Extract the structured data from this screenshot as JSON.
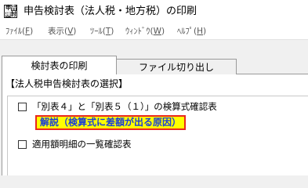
{
  "window": {
    "title": "申告検討表（法人税・地方税）の印刷",
    "icon": "document-grid-icon"
  },
  "menubar": {
    "items": [
      {
        "label": "ﾌｧｲﾙ(",
        "key": "F",
        "suffix": ")"
      },
      {
        "label": "表示(",
        "key": "V",
        "suffix": ")"
      },
      {
        "label": "ﾂｰﾙ(",
        "key": "T",
        "suffix": ")"
      },
      {
        "label": "ｳｨﾝﾄﾞｳ(",
        "key": "W",
        "suffix": ")"
      },
      {
        "label": "ﾍﾙﾌﾟ(",
        "key": "H",
        "suffix": ")"
      }
    ]
  },
  "tabs": [
    {
      "label": "検討表の印刷",
      "active": true
    },
    {
      "label": "ファイル切り出し",
      "active": false
    }
  ],
  "panel": {
    "section_title": "【法人税申告検討表の選択】",
    "options": [
      {
        "label": "「別表４」と「別表５（１）」の検算式確認表",
        "checked": false
      },
      {
        "label": "適用額明細の一覧確認表",
        "checked": false
      }
    ],
    "explain_link": "解説（検算式に差額が出る原因）",
    "colors": {
      "highlight": "#ffff00",
      "highlight_border": "#e8281e",
      "link_text": "#1a3fd6"
    }
  }
}
